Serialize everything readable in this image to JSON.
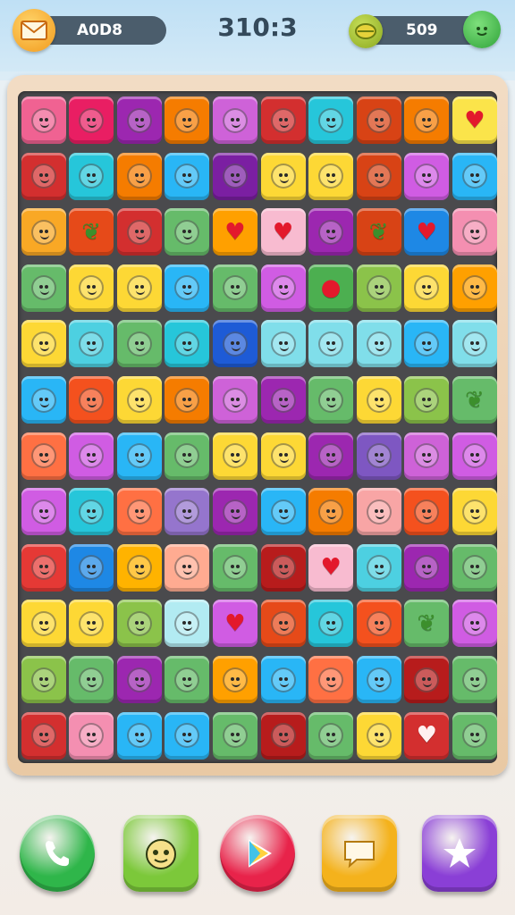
{
  "header": {
    "left_value": "A0D8",
    "score": "310:3",
    "right_value": "509",
    "icons": [
      "mail-icon",
      "leaf-icon",
      "green-blob-icon"
    ]
  },
  "board": {
    "cols": 10,
    "rows": 12,
    "tiles": [
      [
        "#f06292",
        "#e91e63",
        "#9c27b0",
        "#f57c00",
        "#ce62d8",
        "#d32f2f",
        "#26c6da",
        "#d84315",
        "#f57c00",
        "#fbe44a"
      ],
      [
        "#d32f2f",
        "#26c6da",
        "#f57c00",
        "#29b6f6",
        "#7b1fa2",
        "#fdd835",
        "#fdd835",
        "#d84315",
        "#d05ce3",
        "#29b6f6"
      ],
      [
        "#f9a825",
        "#e64a19",
        "#d32f2f",
        "#66bb6a",
        "#ffa000",
        "#f8bbd0",
        "#9c27b0",
        "#d84315",
        "#1e88e5",
        "#f48fb1"
      ],
      [
        "#66bb6a",
        "#fdd835",
        "#fdd835",
        "#29b6f6",
        "#66bb6a",
        "#d05ce3",
        "#4caf50",
        "#8bc34a",
        "#fdd835",
        "#ffa000"
      ],
      [
        "#fdd835",
        "#4dd0e1",
        "#66bb6a",
        "#26c6da",
        "#1e5bd6",
        "#80deea",
        "#80deea",
        "#80deea",
        "#29b6f6",
        "#80deea"
      ],
      [
        "#29b6f6",
        "#f4511e",
        "#fdd835",
        "#f57c00",
        "#ce62d8",
        "#9c27b0",
        "#66bb6a",
        "#fdd835",
        "#8bc34a",
        "#66bb6a"
      ],
      [
        "#ff7043",
        "#d05ce3",
        "#29b6f6",
        "#66bb6a",
        "#fdd835",
        "#fdd835",
        "#9c27b0",
        "#7e57c2",
        "#ce62d8",
        "#d05ce3"
      ],
      [
        "#d05ce3",
        "#26c6da",
        "#ff7043",
        "#9575cd",
        "#9c27b0",
        "#29b6f6",
        "#f57c00",
        "#f8a5a5",
        "#f4511e",
        "#fdd835"
      ],
      [
        "#e53935",
        "#1e88e5",
        "#ffb300",
        "#ffab91",
        "#66bb6a",
        "#b71c1c",
        "#f8bbd0",
        "#4dd0e1",
        "#9c27b0",
        "#66bb6a"
      ],
      [
        "#fdd835",
        "#fdd835",
        "#8bc34a",
        "#b2ebf2",
        "#d05ce3",
        "#e64a19",
        "#26c6da",
        "#f4511e",
        "#66bb6a",
        "#d05ce3"
      ],
      [
        "#8bc34a",
        "#66bb6a",
        "#9c27b0",
        "#66bb6a",
        "#ffa000",
        "#29b6f6",
        "#ff7043",
        "#29b6f6",
        "#b71c1c",
        "#66bb6a"
      ],
      [
        "#d32f2f",
        "#f48fb1",
        "#29b6f6",
        "#29b6f6",
        "#66bb6a",
        "#b71c1c",
        "#66bb6a",
        "#fdd835",
        "#d32f2f",
        "#66bb6a"
      ]
    ],
    "symbols": {
      "0-9": "heart",
      "2-4": "heart",
      "2-5": "heart",
      "2-8": "heart",
      "3-6": "apple",
      "8-6": "heart",
      "9-4": "heart",
      "11-8": "heart",
      "2-1": "leaf",
      "2-7": "leaf",
      "5-9": "leaf",
      "9-8": "leaf"
    }
  },
  "bottom_bar": {
    "buttons": [
      {
        "name": "phone-button",
        "color": "#2fb64a"
      },
      {
        "name": "face-button",
        "color": "#7cc83a"
      },
      {
        "name": "play-button",
        "color": "#e8234a"
      },
      {
        "name": "chat-button",
        "color": "#f4b21c"
      },
      {
        "name": "star-button",
        "color": "#8a3fd6"
      }
    ]
  }
}
